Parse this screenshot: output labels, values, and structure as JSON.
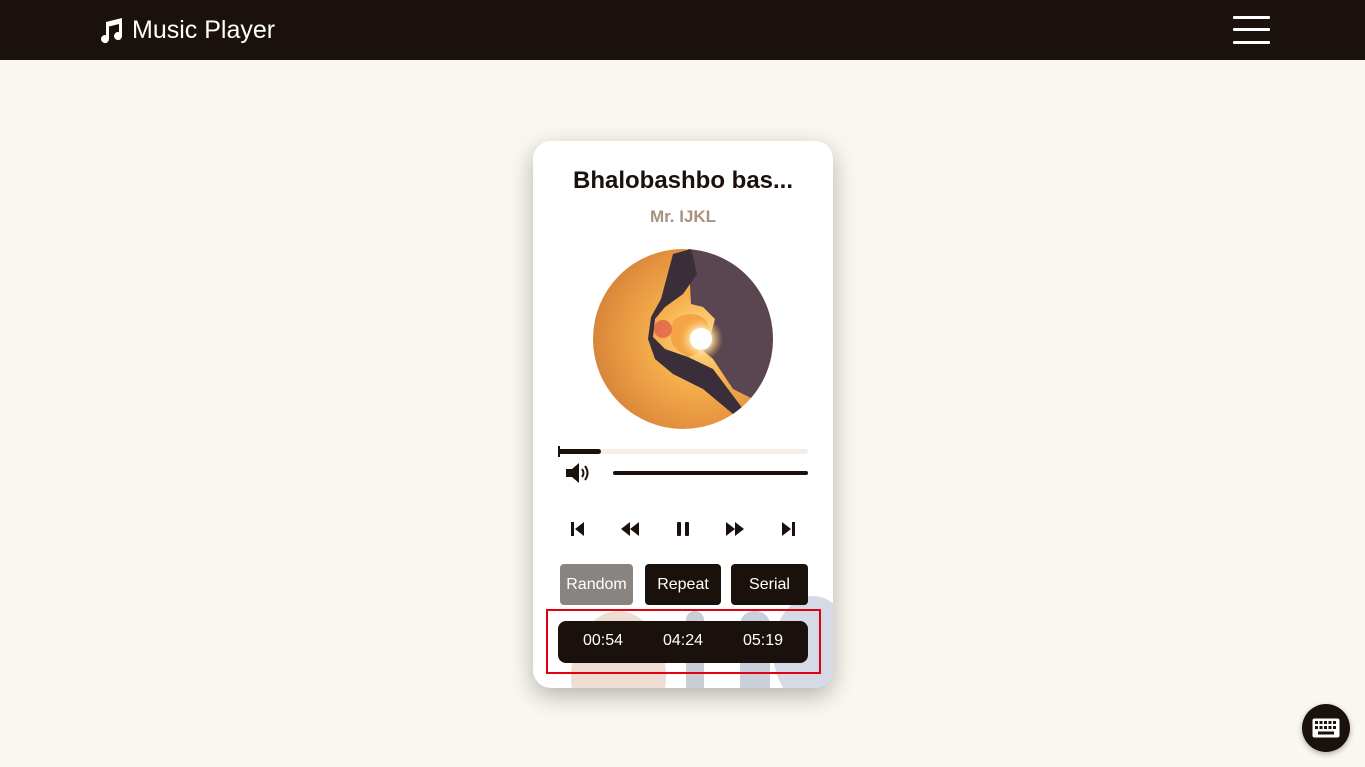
{
  "navbar": {
    "brand_icon": "music-note-icon",
    "brand_label": "Music Player",
    "menu_icon": "hamburger-menu-icon"
  },
  "player": {
    "title": "Bhalobashbo bas...",
    "artist": "Mr. IJKL",
    "album_art": "album-art-heart-hands-sunset",
    "progress_fraction": 0.17,
    "volume_fraction": 1.0,
    "controls": {
      "skip_back": "skip-to-start-icon",
      "rewind": "rewind-icon",
      "pause": "pause-icon",
      "fast_forward": "fast-forward-icon",
      "skip_forward": "skip-to-end-icon",
      "volume": "volume-icon"
    },
    "modes": {
      "random": "Random",
      "repeat": "Repeat",
      "serial": "Serial"
    },
    "times": {
      "elapsed": "00:54",
      "remaining": "04:24",
      "total": "05:19"
    }
  },
  "floating": {
    "keyboard_icon": "keyboard-icon"
  },
  "colors": {
    "primary_dark": "#1b110c",
    "page_bg": "#faf7f0",
    "artist": "#a9927c",
    "random_active": "#8a8480",
    "highlight": "#e3000f"
  }
}
